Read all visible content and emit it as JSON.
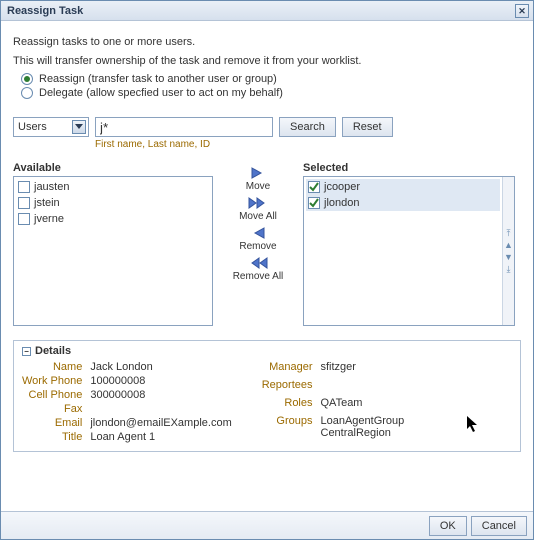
{
  "dialog": {
    "title": "Reassign Task",
    "intro1": "Reassign tasks to one or more users.",
    "intro2": "This will transfer ownership of the task and remove it from your worklist.",
    "radio_reassign": "Reassign (transfer task to another user or group)",
    "radio_delegate": "Delegate (allow specfied user to act on my behalf)"
  },
  "search": {
    "scope": "Users",
    "query": "j*",
    "btn_search": "Search",
    "btn_reset": "Reset",
    "hint": "First name, Last name, ID"
  },
  "picker": {
    "available_label": "Available",
    "selected_label": "Selected",
    "available": [
      "jausten",
      "jstein",
      "jverne"
    ],
    "selected": [
      "jcooper",
      "jlondon"
    ],
    "move": "Move",
    "move_all": "Move All",
    "remove": "Remove",
    "remove_all": "Remove All"
  },
  "details": {
    "heading": "Details",
    "k_name": "Name",
    "v_name": "Jack London",
    "k_wphone": "Work Phone",
    "v_wphone": "100000008",
    "k_cphone": "Cell Phone",
    "v_cphone": "300000008",
    "k_fax": "Fax",
    "v_fax": "",
    "k_email": "Email",
    "v_email": "jlondon@emailEXample.com",
    "k_title": "Title",
    "v_title": "Loan Agent 1",
    "k_manager": "Manager",
    "v_manager": "sfitzger",
    "k_reportees": "Reportees",
    "v_reportees": "",
    "k_roles": "Roles",
    "v_roles": "QATeam",
    "k_groups": "Groups",
    "v_groups1": "LoanAgentGroup",
    "v_groups2": "CentralRegion"
  },
  "footer": {
    "ok": "OK",
    "cancel": "Cancel"
  }
}
